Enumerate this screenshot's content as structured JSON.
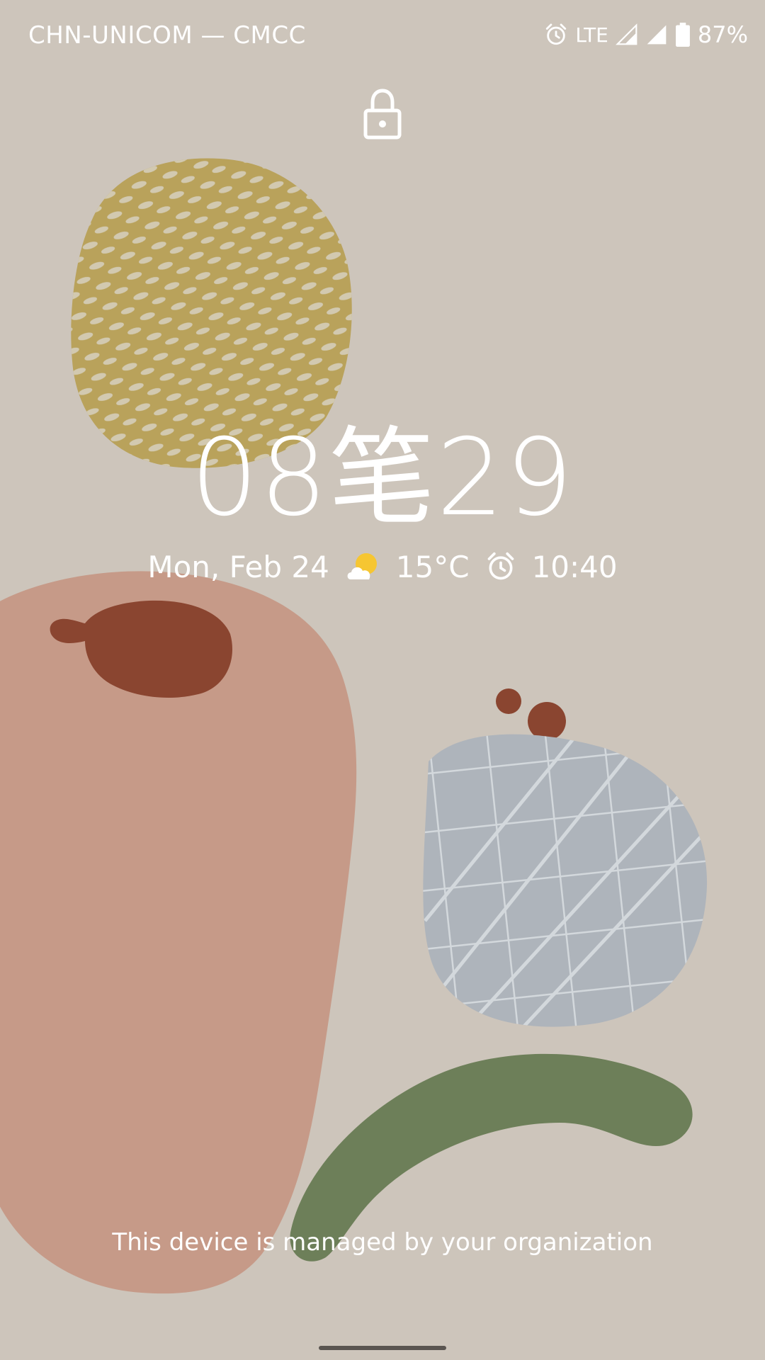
{
  "status_bar": {
    "carrier": "CHN-UNICOM — CMCC",
    "alarm_icon": "alarm-icon",
    "network_type": "LTE",
    "signal_icons": [
      "signal-icon",
      "signal-icon"
    ],
    "battery_icon": "battery-icon",
    "battery_percent": "87%"
  },
  "lock_screen": {
    "lock_icon": "lock-icon",
    "clock_time": "08笔29",
    "date": "Mon, Feb 24",
    "weather_icon": "partly-cloudy-icon",
    "temperature": "15°C",
    "alarm_icon": "alarm-icon",
    "alarm_time": "10:40",
    "managed_notice": "This device is managed by your organization"
  },
  "colors": {
    "background": "#cdc5bb",
    "mustard_blob": "#b9a25b",
    "pink_blob": "#c69a88",
    "brown_spot": "#8a4530",
    "blue_blob": "#aeb4bb",
    "green_stroke": "#6d7f59",
    "text": "#ffffff"
  }
}
